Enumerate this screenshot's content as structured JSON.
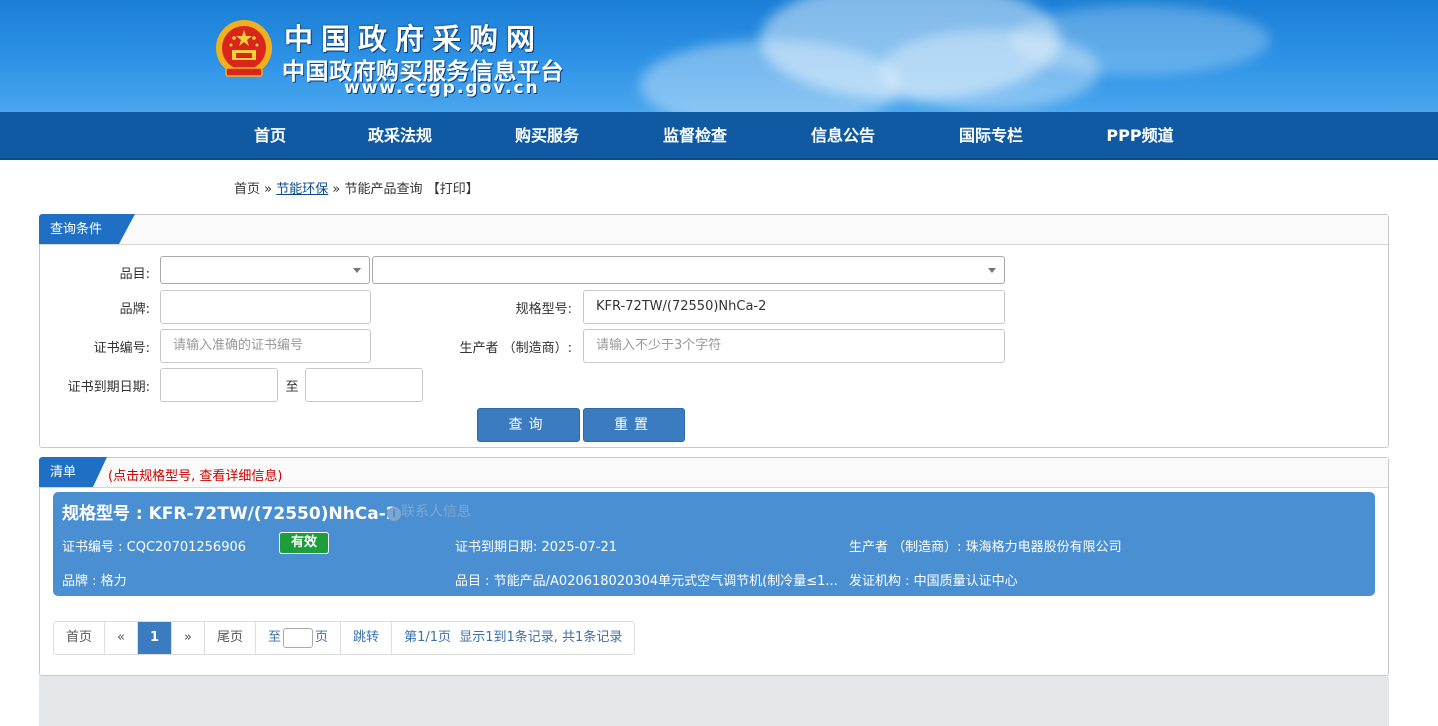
{
  "header": {
    "site_title": "中国政府采购网",
    "site_subtitle": "中国政府购买服务信息平台",
    "site_url": "www.ccgp.gov.cn",
    "emblem_icon": "national-emblem-icon",
    "colors": {
      "banner": "#2e93e6",
      "nav": "#0f5aa3"
    }
  },
  "nav": {
    "items": [
      "首页",
      "政采法规",
      "购买服务",
      "监督检查",
      "信息公告",
      "国际专栏",
      "PPP频道"
    ]
  },
  "breadcrumb": {
    "home": "首页",
    "sep1": "»",
    "section": "节能环保",
    "sep2": "»",
    "current": "节能产品查询",
    "print": "【打印】"
  },
  "query": {
    "tab_label": "查询条件",
    "category_label": "品目:",
    "brand_label": "品牌:",
    "model_label": "规格型号:",
    "model_value": "KFR-72TW/(72550)NhCa-2",
    "cert_label": "证书编号:",
    "cert_placeholder": "请输入准确的证书编号",
    "producer_label": "生产者 （制造商）:",
    "producer_placeholder": "请输入不少于3个字符",
    "expire_label": "证书到期日期:",
    "to_label": "至",
    "search_button": "查询",
    "reset_button": "重置"
  },
  "results": {
    "tab_label": "清单",
    "hint": "(点击规格型号, 查看详细信息)",
    "hint_color": "#cc0000",
    "items": [
      {
        "model": "规格型号 : KFR-72TW/(72550)NhCa-2",
        "contact": "联系人信息",
        "cert": "证书编号 : CQC20701256906",
        "status": "有效",
        "status_color": "#1e9e3a",
        "expire": "证书到期日期: 2025-07-21",
        "producer": "生产者 （制造商）: 珠海格力电器股份有限公司",
        "brand": "品牌 : 格力",
        "category": "品目 : 节能产品/A020618020304单元式空气调节机(制冷量≤1...",
        "issuer": "发证机构 : 中国质量认证中心"
      }
    ]
  },
  "pager": {
    "first": "首页",
    "prev": "«",
    "current_page": "1",
    "next": "»",
    "last": "尾页",
    "goto_prefix": "至",
    "goto_suffix": "页",
    "jump": "跳转",
    "summary": "第1/1页  显示1到1条记录, 共1条记录"
  }
}
